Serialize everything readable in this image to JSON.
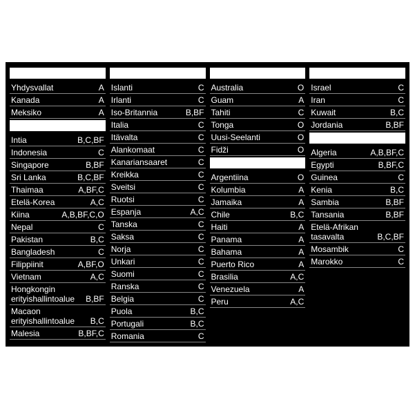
{
  "columns": [
    {
      "regions": [
        {
          "header": " ",
          "rows": [
            {
              "country": "Yhdysvallat",
              "code": "A"
            },
            {
              "country": "Kanada",
              "code": "A"
            },
            {
              "country": "Meksiko",
              "code": "A"
            }
          ]
        },
        {
          "header": " ",
          "rows": [
            {
              "country": "Intia",
              "code": "B,C,BF"
            },
            {
              "country": "Indonesia",
              "code": "C"
            },
            {
              "country": "Singapore",
              "code": "B,BF"
            },
            {
              "country": "Sri Lanka",
              "code": "B,C,BF"
            },
            {
              "country": "Thaimaa",
              "code": "A,BF,C"
            },
            {
              "country": "Etelä-Korea",
              "code": "A,C"
            },
            {
              "country": "Kiina",
              "code": "A,B,BF,C,O"
            },
            {
              "country": "Nepal",
              "code": "C"
            },
            {
              "country": "Pakistan",
              "code": "B,C"
            },
            {
              "country": "Bangladesh",
              "code": "C"
            },
            {
              "country": "Filippiinit",
              "code": "A,BF,O"
            },
            {
              "country": "Vietnam",
              "code": "A,C"
            },
            {
              "country": "Hongkongin erityishallintoalue",
              "code": "B,BF"
            },
            {
              "country": "Macaon erityishallintoalue",
              "code": "B,C"
            },
            {
              "country": "Malesia",
              "code": "B,BF,C"
            }
          ]
        }
      ]
    },
    {
      "regions": [
        {
          "header": " ",
          "rows": [
            {
              "country": "Islanti",
              "code": "C"
            },
            {
              "country": "Irlanti",
              "code": "C"
            },
            {
              "country": "Iso-Britannia",
              "code": "B,BF"
            },
            {
              "country": "Italia",
              "code": "C"
            },
            {
              "country": "Itävalta",
              "code": "C"
            },
            {
              "country": "Alankomaat",
              "code": "C"
            },
            {
              "country": "Kanariansaaret",
              "code": "C"
            },
            {
              "country": "Kreikka",
              "code": "C"
            },
            {
              "country": "Sveitsi",
              "code": "C"
            },
            {
              "country": "Ruotsi",
              "code": "C"
            },
            {
              "country": "Espanja",
              "code": "A,C"
            },
            {
              "country": "Tanska",
              "code": "C"
            },
            {
              "country": "Saksa",
              "code": "C"
            },
            {
              "country": "Norja",
              "code": "C"
            },
            {
              "country": "Unkari",
              "code": "C"
            },
            {
              "country": "Suomi",
              "code": "C"
            },
            {
              "country": "Ranska",
              "code": "C"
            },
            {
              "country": "Belgia",
              "code": "C"
            },
            {
              "country": "Puola",
              "code": "B,C"
            },
            {
              "country": "Portugali",
              "code": "B,C"
            },
            {
              "country": "Romania",
              "code": "C"
            }
          ]
        }
      ]
    },
    {
      "regions": [
        {
          "header": " ",
          "rows": [
            {
              "country": "Australia",
              "code": "O"
            },
            {
              "country": "Guam",
              "code": "A"
            },
            {
              "country": "Tahiti",
              "code": "C"
            },
            {
              "country": "Tonga",
              "code": "O"
            },
            {
              "country": "Uusi-Seelanti",
              "code": "O"
            },
            {
              "country": "Fidži",
              "code": "O"
            }
          ]
        },
        {
          "header": " ",
          "rows": [
            {
              "country": "Argentiina",
              "code": "O"
            },
            {
              "country": "Kolumbia",
              "code": "A"
            },
            {
              "country": "Jamaika",
              "code": "A"
            },
            {
              "country": "Chile",
              "code": "B,C"
            },
            {
              "country": "Haiti",
              "code": "A"
            },
            {
              "country": "Panama",
              "code": "A"
            },
            {
              "country": "Bahama",
              "code": "A"
            },
            {
              "country": "Puerto Rico",
              "code": "A"
            },
            {
              "country": "Brasilia",
              "code": "A,C"
            },
            {
              "country": "Venezuela",
              "code": "A"
            },
            {
              "country": "Peru",
              "code": "A,C"
            }
          ]
        }
      ]
    },
    {
      "regions": [
        {
          "header": " ",
          "rows": [
            {
              "country": "Israel",
              "code": "C"
            },
            {
              "country": "Iran",
              "code": "C"
            },
            {
              "country": "Kuwait",
              "code": "B,C"
            },
            {
              "country": "Jordania",
              "code": "B,BF"
            }
          ]
        },
        {
          "header": " ",
          "rows": [
            {
              "country": "Algeria",
              "code": "A,B,BF,C"
            },
            {
              "country": "Egypti",
              "code": "B,BF,C"
            },
            {
              "country": "Guinea",
              "code": "C"
            },
            {
              "country": "Kenia",
              "code": "B,C"
            },
            {
              "country": "Sambia",
              "code": "B,BF"
            },
            {
              "country": "Tansania",
              "code": "B,BF"
            },
            {
              "country": "Etelä-Afrikan tasavalta",
              "code": "B,C,BF"
            },
            {
              "country": "Mosambik",
              "code": "C"
            },
            {
              "country": "Marokko",
              "code": "C"
            }
          ]
        }
      ]
    }
  ]
}
